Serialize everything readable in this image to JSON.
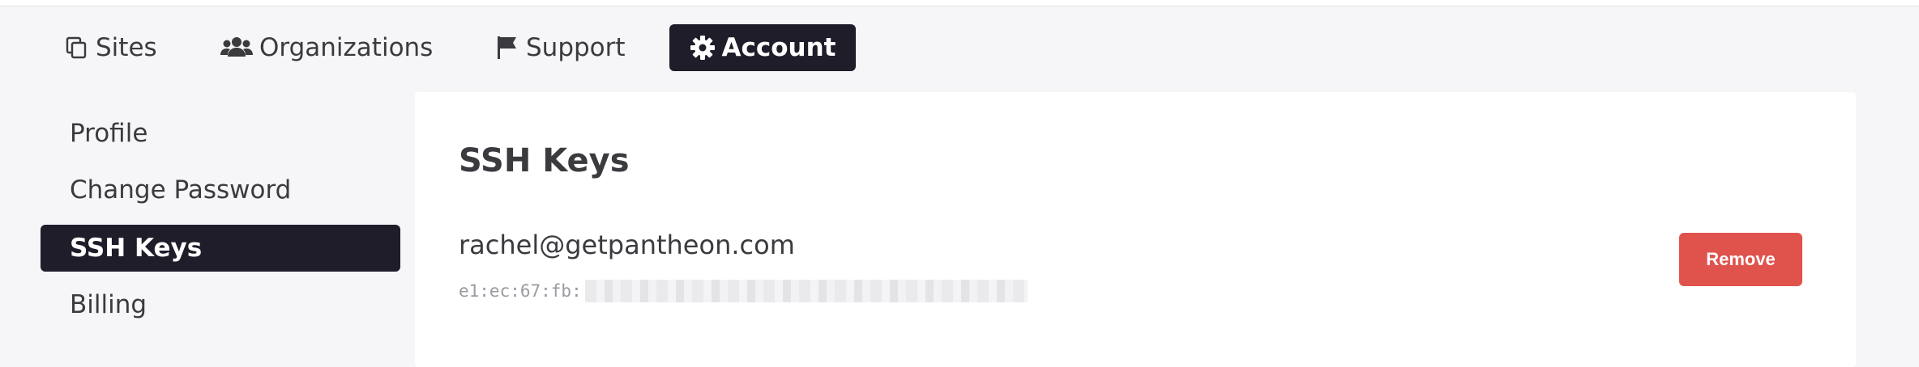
{
  "topnav": {
    "tabs": [
      {
        "label": "Sites",
        "icon": "copy-icon"
      },
      {
        "label": "Organizations",
        "icon": "users-icon"
      },
      {
        "label": "Support",
        "icon": "flag-icon"
      },
      {
        "label": "Account",
        "icon": "gear-icon",
        "active": true
      }
    ]
  },
  "sidebar": {
    "items": [
      {
        "label": "Profile"
      },
      {
        "label": "Change Password"
      },
      {
        "label": "SSH Keys",
        "active": true
      },
      {
        "label": "Billing"
      }
    ]
  },
  "main": {
    "title": "SSH Keys",
    "key": {
      "email": "rachel@getpantheon.com",
      "fingerprint_prefix": "e1:ec:67:fb:",
      "remove_label": "Remove"
    }
  },
  "colors": {
    "active_bg": "#1f1d2a",
    "danger": "#e0534c",
    "page_bg": "#f6f6f8"
  }
}
